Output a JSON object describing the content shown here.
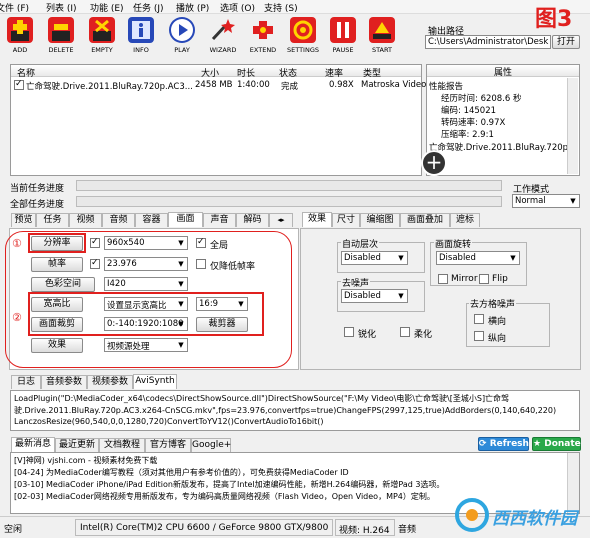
{
  "menu": [
    "文件 (F)",
    "列表 (I)",
    "功能 (E)",
    "任务 (J)",
    "播放 (P)",
    "选项 (O)",
    "支持 (S)"
  ],
  "toolbar": [
    {
      "label": "ADD",
      "icon": "add-icon",
      "color": "#d81e1e"
    },
    {
      "label": "DELETE",
      "icon": "delete-icon",
      "color": "#d81e1e"
    },
    {
      "label": "EMPTY",
      "icon": "empty-icon",
      "color": "#d81e1e"
    },
    {
      "label": "INFO",
      "icon": "info-icon",
      "color": "#2d57c7"
    },
    {
      "label": "PLAY",
      "icon": "play-icon",
      "color": "#2d57c7"
    },
    {
      "label": "WIZARD",
      "icon": "wizard-icon",
      "color": "#d81e1e"
    },
    {
      "label": "EXTEND",
      "icon": "extend-icon",
      "color": "#d81e1e"
    },
    {
      "label": "SETTINGS",
      "icon": "settings-icon",
      "color": "#d81e1e"
    },
    {
      "label": "PAUSE",
      "icon": "pause-icon",
      "color": "#d81e1e"
    },
    {
      "label": "START",
      "icon": "start-icon",
      "color": "#d81e1e"
    }
  ],
  "figure_label": "图3",
  "output": {
    "label": "输出路径",
    "path": "C:\\Users\\Administrator\\Desk",
    "open_button": "打开"
  },
  "filelist": {
    "headers": [
      "名称",
      "大小",
      "时长",
      "状态",
      "速率",
      "类型"
    ],
    "rows": [
      {
        "name": "亡命驾驶.Drive.2011.BluRay.720p.AC3...",
        "size": "2458 MB",
        "duration": "1:40:00",
        "status": "完成",
        "rate": "0.98X",
        "type": "Matroska Video"
      }
    ]
  },
  "properties": {
    "header": "属性",
    "lines": [
      "性能报告",
      "经历时间: 6208.6 秒",
      "编码: 145021",
      "转码速率: 0.97X",
      "压缩率: 2.9:1",
      "亡命驾驶.Drive.2011.BluRay.720p.A"
    ]
  },
  "progress": {
    "current": "当前任务进度",
    "all": "全部任务进度"
  },
  "work_mode": {
    "label": "工作模式",
    "value": "Normal"
  },
  "left_tabs": [
    "预览",
    "任务",
    "视频",
    "音频",
    "容器",
    "画面",
    "声音",
    "解码"
  ],
  "left_tabs_active": 5,
  "picture": {
    "marker1": "①",
    "marker2": "②",
    "resolution_btn": "分辨率",
    "resolution_value": "960x540",
    "global_label": "全局",
    "framerate_btn": "帧率",
    "framerate_value": "23.976",
    "reduce_label": "仅降低帧率",
    "colorspace_btn": "色彩空间",
    "colorspace_value": "I420",
    "aspect_btn": "宽高比",
    "aspect_value": "设置显示宽高比",
    "aspect_ratio": "16:9",
    "crop_btn": "画面裁剪",
    "crop_value": "0:-140:1920:1080",
    "cropper_btn": "裁剪器",
    "effect_btn": "效果",
    "effect_value": "视频源处理"
  },
  "right_tabs": [
    "效果",
    "尺寸",
    "编缩图",
    "画面叠加",
    "遮标"
  ],
  "effects": {
    "auto_level": "自动层次",
    "auto_level_value": "Disabled",
    "rotate": "画面旋转",
    "rotate_value": "Disabled",
    "mirror": "Mirror",
    "flip": "Flip",
    "denoise": "去噪声",
    "denoise_value": "Disabled",
    "deblock": "去方格噪声",
    "horizontal": "横向",
    "vertical": "纵向",
    "sharpen": "锐化",
    "soften": "柔化"
  },
  "bottom_tabs": [
    "日志",
    "音频参数",
    "视频参数",
    "AviSynth"
  ],
  "bottom_tabs_active": 3,
  "avisynth": [
    "LoadPlugin(\"D:\\MediaCoder_x64\\codecs\\DirectShowSource.dll\")DirectShowSource(\"F:\\My Video\\电影\\亡命驾驶\\[圣城小S]亡命驾",
    "驶.Drive.2011.BluRay.720p.AC3.x264-CnSCG.mkv\",fps=23.976,convertfps=true)ChangeFPS(2997,125,true)AddBorders(0,140,640,220)",
    "LanczosResize(960,540,0,0,1280,720)ConvertToYV12()ConvertAudioTo16bit()"
  ],
  "news_tabs": [
    "最新消息",
    "最近更新",
    "文档教程",
    "官方博客",
    "Google+"
  ],
  "refresh_btn": "Refresh",
  "donate_btn": "Donate",
  "news": [
    "[V]神网) vjshi.com - 视频素材免费下载",
    "[04-24] 为MediaCoder编写教程（须对其他用户有参考价值的），可免费获得MediaCoder ID",
    "[03-10] MediaCoder iPhone/iPad Edition新版发布，提高了Intel加速编码性能，新增H.264编码器，新增Pad 3选项。",
    "[02-03] MediaCoder网络视频专用新版发布，专为编码高质量网络视频（Flash Video，Open Video，MP4）定制。"
  ],
  "status": {
    "state": "空闲",
    "cpu": "Intel(R) Core(TM)2 CPU 6600  / GeForce 9800 GTX/9800",
    "video": "视频: H.264",
    "audio": "音频"
  },
  "watermark": "西西软件园"
}
